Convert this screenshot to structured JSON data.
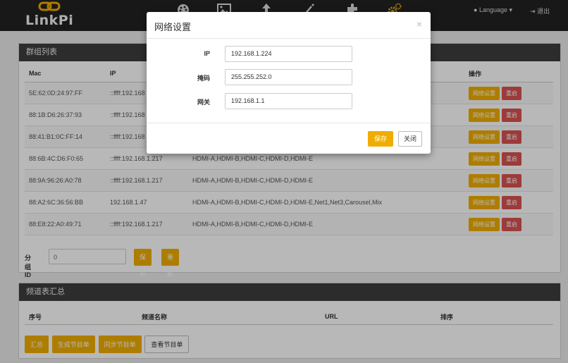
{
  "brand": {
    "name": "LinkPi"
  },
  "nav": {
    "icons": [
      "palette-icon",
      "image-icon",
      "upload-icon",
      "magic-wand-icon",
      "puzzle-icon",
      "gears-icon"
    ],
    "active_color": "#f0ad00",
    "language_label": "Language",
    "logout_label": "退出"
  },
  "group_panel": {
    "title": "群组列表",
    "columns": [
      "Mac",
      "IP",
      "",
      "操作"
    ],
    "rows": [
      {
        "mac": "5E:62:0D:24:97:FF",
        "ip": "::ffff:192.168",
        "channels": ""
      },
      {
        "mac": "88:1B:D6:26:37:93",
        "ip": "::ffff:192.168",
        "channels": ""
      },
      {
        "mac": "88:41:B1:0C:FF:14",
        "ip": "::ffff:192.168",
        "channels": ""
      },
      {
        "mac": "88:6B:4C:D6:F0:65",
        "ip": "::ffff:192.168.1.217",
        "channels": "HDMI-A,HDMI-B,HDMI-C,HDMI-D,HDMI-E"
      },
      {
        "mac": "88:9A:96:26:A0:78",
        "ip": "::ffff:192.168.1.217",
        "channels": "HDMI-A,HDMI-B,HDMI-C,HDMI-D,HDMI-E"
      },
      {
        "mac": "88:A2:6C:36:56:BB",
        "ip": "192.168.1.47",
        "channels": "HDMI-A,HDMI-B,HDMI-C,HDMI-D,HDMI-E,Net1,Net3,Carousel,Mix"
      },
      {
        "mac": "88:E8:22:A0:49:71",
        "ip": "::ffff:192.168.1.217",
        "channels": "HDMI-A,HDMI-B,HDMI-C,HDMI-D,HDMI-E"
      }
    ],
    "row_net_button": "网络设置",
    "row_reboot_button": "重启",
    "group_id_label": "分组ID",
    "group_id_placeholder": "0",
    "save_button": "保存",
    "rescan_button": "重新搜索"
  },
  "channel_panel": {
    "title": "频道表汇总",
    "columns": [
      "序号",
      "频道名称",
      "URL",
      "排序"
    ],
    "buttons": {
      "summary": "汇总",
      "generate": "生成节目单",
      "sync": "同步节目单",
      "view": "查看节目单"
    }
  },
  "modal": {
    "title": "网络设置",
    "close_symbol": "×",
    "fields": [
      {
        "label": "IP",
        "value": "192.168.1.224"
      },
      {
        "label": "掩码",
        "value": "255.255.252.0"
      },
      {
        "label": "网关",
        "value": "192.168.1.1"
      }
    ],
    "save_button": "保存",
    "close_button": "关闭"
  }
}
